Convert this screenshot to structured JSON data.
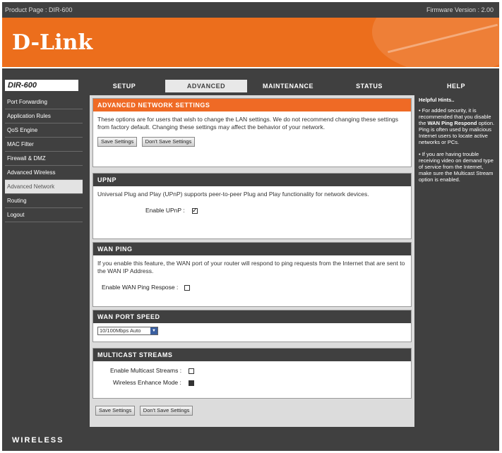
{
  "topbar": {
    "product_page": "Product Page : DIR-600",
    "firmware": "Firmware Version : 2.00"
  },
  "brand": {
    "logo": "D-Link"
  },
  "model": "DIR-600",
  "tabs": [
    {
      "label": "SETUP"
    },
    {
      "label": "ADVANCED"
    },
    {
      "label": "MAINTENANCE"
    },
    {
      "label": "STATUS"
    },
    {
      "label": "HELP"
    }
  ],
  "nav": [
    "Port Forwarding",
    "Application Rules",
    "QoS Engine",
    "MAC Filter",
    "Firewall & DMZ",
    "Advanced Wireless",
    "Advanced Network",
    "Routing",
    "Logout"
  ],
  "main": {
    "adv": {
      "title": "ADVANCED NETWORK SETTINGS",
      "desc": "These options are for users that wish to change the LAN settings. We do not recommend changing these settings from factory default. Changing these settings may affect the behavior of your network.",
      "save": "Save Settings",
      "dont_save": "Don't Save Settings"
    },
    "upnp": {
      "title": "UPNP",
      "desc": "Universal Plug and Play (UPnP) supports peer-to-peer Plug and Play functionality for network devices.",
      "label": "Enable UPnP :"
    },
    "wanping": {
      "title": "WAN PING",
      "desc": "If you enable this feature, the WAN port of your router will respond to ping requests from the Internet that are sent to the WAN IP Address.",
      "label": "Enable WAN Ping Respose :"
    },
    "wanspeed": {
      "title": "WAN PORT SPEED",
      "value": "10/100Mbps Auto"
    },
    "multicast": {
      "title": "MULTICAST STREAMS",
      "label1": "Enable Multicast Streams :",
      "label2": "Wireless Enhance Mode :"
    },
    "bottom_save": "Save Settings",
    "bottom_dont_save": "Don't Save Settings"
  },
  "help": {
    "title": "Helpful Hints..",
    "p1a": "• For added security, it is recommended that you disable the ",
    "p1b": "WAN Ping Respond",
    "p1c": " option. Ping is often used by malicious Internet users to locate active networks or PCs.",
    "p2": "• If you are having trouble receiving video on demand type of service from the Internet, make sure the Multicast Stream option is enabled."
  },
  "footer": {
    "label": "WIRELESS"
  }
}
